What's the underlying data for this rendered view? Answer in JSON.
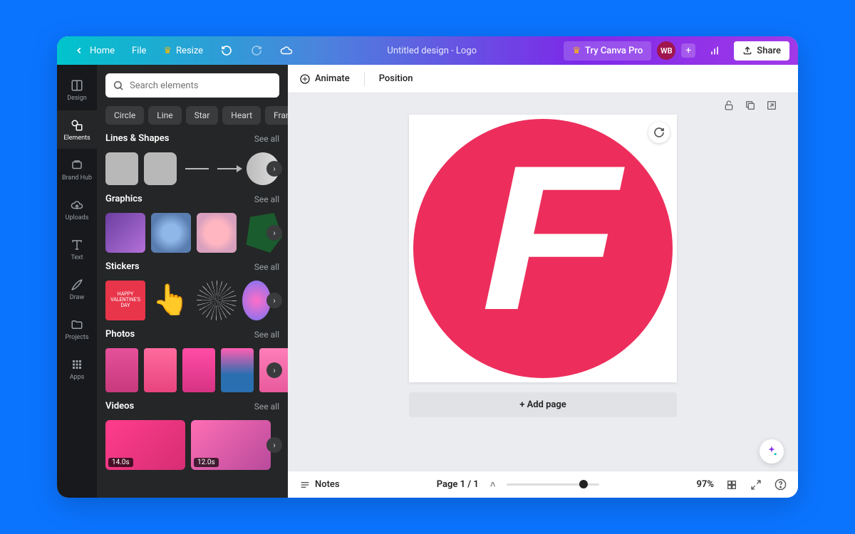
{
  "topbar": {
    "home": "Home",
    "file": "File",
    "resize": "Resize",
    "doc_title": "Untitled design - Logo",
    "try_pro": "Try Canva Pro",
    "avatar_initials": "WB",
    "share": "Share"
  },
  "sidenav": [
    {
      "id": "design",
      "label": "Design"
    },
    {
      "id": "elements",
      "label": "Elements"
    },
    {
      "id": "brand-hub",
      "label": "Brand Hub"
    },
    {
      "id": "uploads",
      "label": "Uploads"
    },
    {
      "id": "text",
      "label": "Text"
    },
    {
      "id": "draw",
      "label": "Draw"
    },
    {
      "id": "projects",
      "label": "Projects"
    },
    {
      "id": "apps",
      "label": "Apps"
    }
  ],
  "panel": {
    "search_placeholder": "Search elements",
    "chips": [
      "Circle",
      "Line",
      "Star",
      "Heart",
      "Frame"
    ],
    "sections": {
      "lines_shapes": {
        "title": "Lines & Shapes",
        "see_all": "See all"
      },
      "graphics": {
        "title": "Graphics",
        "see_all": "See all"
      },
      "stickers": {
        "title": "Stickers",
        "see_all": "See all"
      },
      "photos": {
        "title": "Photos",
        "see_all": "See all"
      },
      "videos": {
        "title": "Videos",
        "see_all": "See all"
      }
    },
    "video_durations": [
      "14.0s",
      "12.0s"
    ]
  },
  "toolbar": {
    "animate": "Animate",
    "position": "Position"
  },
  "canvas": {
    "add_page": "+ Add page",
    "logo_letter": "F",
    "logo_color": "#ed2e5c"
  },
  "bottombar": {
    "notes": "Notes",
    "page_label": "Page 1 / 1",
    "zoom": "97%"
  }
}
